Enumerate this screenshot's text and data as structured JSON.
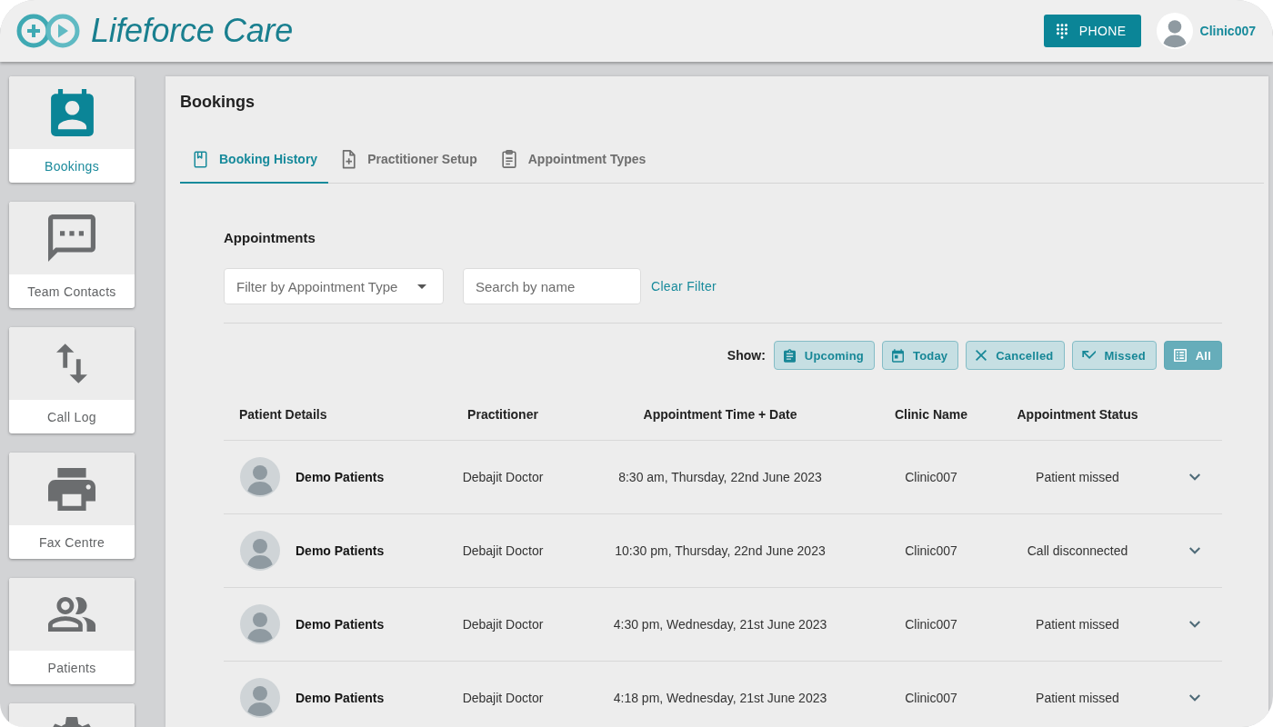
{
  "header": {
    "brand": "Lifeforce Care",
    "phone_button": "PHONE",
    "user_name": "Clinic007"
  },
  "sidebar": {
    "items": [
      {
        "label": "Bookings",
        "selected": true
      },
      {
        "label": "Team Contacts",
        "selected": false
      },
      {
        "label": "Call Log",
        "selected": false
      },
      {
        "label": "Fax Centre",
        "selected": false
      },
      {
        "label": "Patients",
        "selected": false
      },
      {
        "selected": false
      }
    ]
  },
  "page": {
    "title": "Bookings",
    "tabs": [
      {
        "label": "Booking History",
        "selected": true
      },
      {
        "label": "Practitioner Setup",
        "selected": false
      },
      {
        "label": "Appointment Types",
        "selected": false
      }
    ]
  },
  "appointments": {
    "title": "Appointments",
    "filter_select": {
      "placeholder": "Filter by Appointment Type"
    },
    "search": {
      "placeholder": "Search by name"
    },
    "clear_filter": "Clear Filter",
    "show_label": "Show:",
    "show_filters": [
      {
        "label": "Upcoming",
        "selected": false
      },
      {
        "label": "Today",
        "selected": false
      },
      {
        "label": "Cancelled",
        "selected": false
      },
      {
        "label": "Missed",
        "selected": false
      },
      {
        "label": "All",
        "selected": true
      }
    ],
    "table": {
      "columns": [
        "Patient Details",
        "Practitioner",
        "Appointment Time + Date",
        "Clinic Name",
        "Appointment Status"
      ],
      "rows": [
        {
          "patient": "Demo Patients",
          "practitioner": "Debajit Doctor",
          "appointment_time": "8:30 am, Thursday, 22nd June 2023",
          "clinic": "Clinic007",
          "status": "Patient missed"
        },
        {
          "patient": "Demo Patients",
          "practitioner": "Debajit Doctor",
          "appointment_time": "10:30 pm, Thursday, 22nd June 2023",
          "clinic": "Clinic007",
          "status": "Call disconnected"
        },
        {
          "patient": "Demo Patients",
          "practitioner": "Debajit Doctor",
          "appointment_time": "4:30 pm, Wednesday, 21st June 2023",
          "clinic": "Clinic007",
          "status": "Patient missed"
        },
        {
          "patient": "Demo Patients",
          "practitioner": "Debajit Doctor",
          "appointment_time": "4:18 pm, Wednesday, 21st June 2023",
          "clinic": "Clinic007",
          "status": "Patient missed"
        }
      ]
    }
  }
}
